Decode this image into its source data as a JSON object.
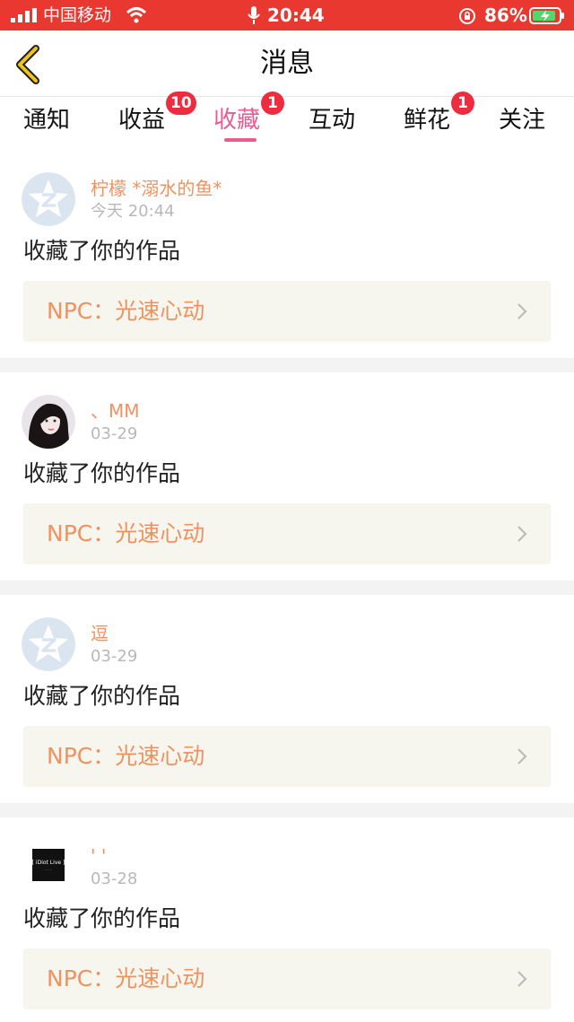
{
  "status_bar": {
    "carrier": "中国移动",
    "time": "20:44",
    "battery": "86%"
  },
  "nav": {
    "title": "消息",
    "back_icon": "chevron-left-icon",
    "back_color": "#f0c419"
  },
  "tabs": [
    {
      "label": "通知",
      "badge": ""
    },
    {
      "label": "收益",
      "badge": "10"
    },
    {
      "label": "收藏",
      "badge": "1",
      "active": true
    },
    {
      "label": "互动",
      "badge": ""
    },
    {
      "label": "鲜花",
      "badge": "1"
    },
    {
      "label": "关注",
      "badge": ""
    }
  ],
  "colors": {
    "accent": "#e85c91",
    "badge": "#ed2d3f",
    "username": "#ee925f",
    "status_bar": "#e8382f"
  },
  "messages": [
    {
      "username": "柠檬 *溺水的鱼*",
      "time": "今天 20:44",
      "action": "收藏了你的作品",
      "work": "NPC：光速心动",
      "avatar": "default-avatar-icon"
    },
    {
      "username": "、MM",
      "time": "03-29",
      "action": "收藏了你的作品",
      "work": "NPC：光速心动",
      "avatar": "user-photo"
    },
    {
      "username": "逗",
      "time": "03-29",
      "action": "收藏了你的作品",
      "work": "NPC：光速心动",
      "avatar": "default-avatar-icon"
    },
    {
      "username": "' '",
      "time": "03-28",
      "action": "收藏了你的作品",
      "work": "NPC：光速心动",
      "avatar": "user-logo"
    }
  ],
  "avatar_logo_text": "iDiot Live"
}
